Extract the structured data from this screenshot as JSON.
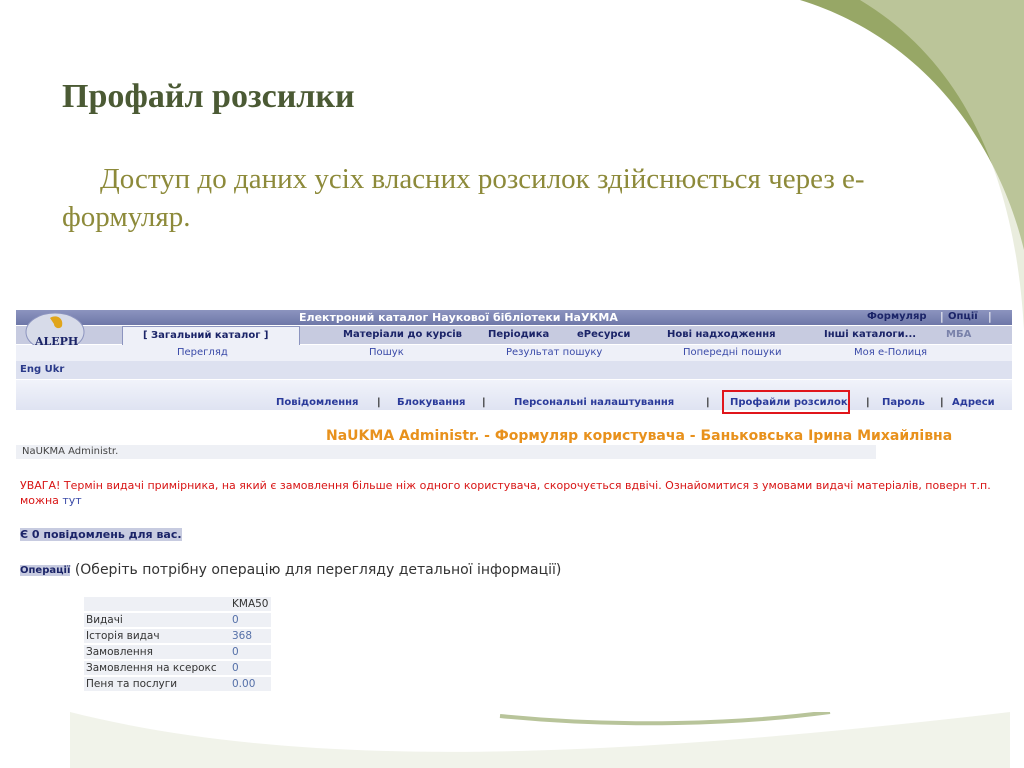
{
  "slide": {
    "title": "Профайл розсилки",
    "body": "Доступ до даних усіх власних розсилок здійснюється через е-формуляр."
  },
  "app": {
    "logo_text": "ALEPH",
    "window_title": "Електроний каталог Наукової бібліотеки НаУКМА",
    "top_links": [
      "Формуляр",
      "Опції"
    ],
    "main_tabs": [
      "[ Загальний каталог ]",
      "Матеріали до курсів",
      "Періодика",
      "еРесурси",
      "Нові надходження",
      "Інші каталоги...",
      "МБА"
    ],
    "sub_nav": [
      "Перегляд",
      "Пошук",
      "Результат пошуку",
      "Попередні пошуки",
      "Моя е-Полиця"
    ],
    "language_bar": "Eng Ukr",
    "account_nav": [
      "Повідомлення",
      "Блокування",
      "Персональні налаштування",
      "Профайли розсилок",
      "Пароль",
      "Адреси"
    ],
    "highlighted_nav": "Профайли розсилок",
    "patron_title": "NaUKMA Administr. - Формуляр користувача - Баньковська Ірина Михайлівна",
    "admin_label": "NaUKMA Administr.",
    "warning_text": "УВАГА! Термін видачі примірника, на який є замовлення більше ніж одного користувача, скорочується вдвічі. Ознайомитися з умовами видачі матеріалів, поверн т.п. можна ",
    "warning_link": "тут",
    "messages": "Є 0 повідомлень для вас.",
    "operations_label": "Операції",
    "operations_hint": "(Оберіть потрібну операцію для перегляду детальної інформації)",
    "table": {
      "column_header": "KMA50",
      "rows": [
        {
          "label": "Видачі",
          "value": "0"
        },
        {
          "label": "Історія видач",
          "value": "368"
        },
        {
          "label": "Замовлення",
          "value": "0"
        },
        {
          "label": "Замовлення на ксерокс",
          "value": "0"
        },
        {
          "label": "Пеня та послуги",
          "value": "0.00"
        }
      ]
    }
  },
  "colors": {
    "title": "#4b5a34",
    "body": "#8d8a3a",
    "deco_green": "#8c9d5e",
    "highlight_box": "#e0151b",
    "patron_title": "#e8911c",
    "warning": "#d81414"
  }
}
